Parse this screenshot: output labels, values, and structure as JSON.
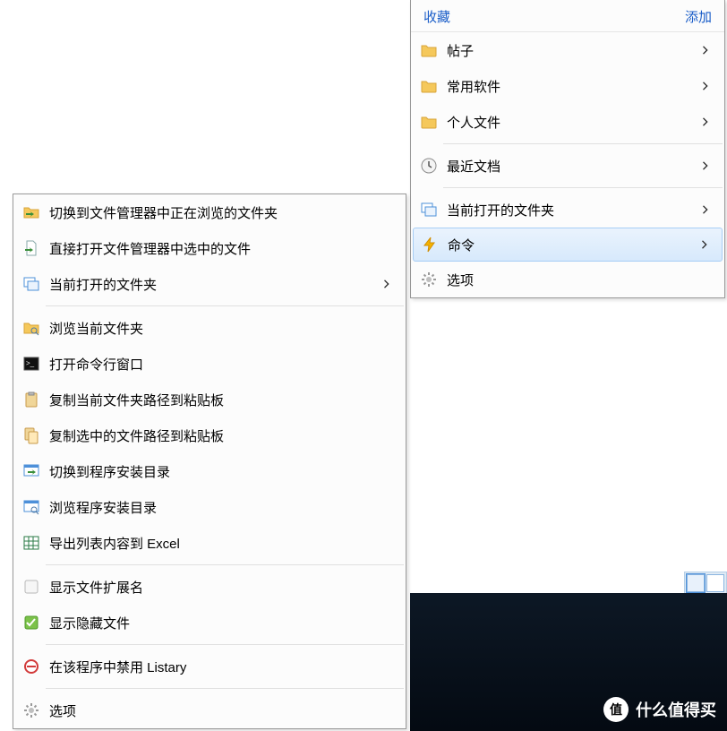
{
  "right_menu": {
    "header": {
      "left": "收藏",
      "right": "添加"
    },
    "items": [
      {
        "id": "posts",
        "icon": "folder",
        "label": "帖子",
        "chevron": true
      },
      {
        "id": "common-sw",
        "icon": "folder",
        "label": "常用软件",
        "chevron": true
      },
      {
        "id": "personal",
        "icon": "folder",
        "label": "个人文件",
        "chevron": true
      },
      {
        "sep": true
      },
      {
        "id": "recent",
        "icon": "clock",
        "label": "最近文档",
        "chevron": true
      },
      {
        "sep": true
      },
      {
        "id": "open-folders",
        "icon": "windows",
        "label": "当前打开的文件夹",
        "chevron": true
      },
      {
        "id": "commands",
        "icon": "bolt",
        "label": "命令",
        "chevron": true,
        "highlight": true
      },
      {
        "id": "options",
        "icon": "gear",
        "label": "选项",
        "chevron": false
      }
    ]
  },
  "left_menu": {
    "items": [
      {
        "id": "switch-fm-folder",
        "icon": "folder-arrow",
        "label": "切换到文件管理器中正在浏览的文件夹",
        "chevron": false
      },
      {
        "id": "open-fm-file",
        "icon": "file-arrow",
        "label": "直接打开文件管理器中选中的文件",
        "chevron": false
      },
      {
        "id": "open-folders-2",
        "icon": "windows",
        "label": "当前打开的文件夹",
        "chevron": true
      },
      {
        "sep": true
      },
      {
        "id": "browse-folder",
        "icon": "folder-search",
        "label": "浏览当前文件夹",
        "chevron": false
      },
      {
        "id": "open-cmd",
        "icon": "terminal",
        "label": "打开命令行窗口",
        "chevron": false
      },
      {
        "id": "copy-folder-path",
        "icon": "clipboard",
        "label": "复制当前文件夹路径到粘贴板",
        "chevron": false
      },
      {
        "id": "copy-file-path",
        "icon": "clipboard-multi",
        "label": "复制选中的文件路径到粘贴板",
        "chevron": false
      },
      {
        "id": "switch-install",
        "icon": "window-go",
        "label": "切换到程序安装目录",
        "chevron": false
      },
      {
        "id": "browse-install",
        "icon": "window-search",
        "label": "浏览程序安装目录",
        "chevron": false
      },
      {
        "id": "export-excel",
        "icon": "excel",
        "label": "导出列表内容到 Excel",
        "chevron": false
      },
      {
        "sep": true
      },
      {
        "id": "show-ext",
        "icon": "check-off",
        "label": "显示文件扩展名",
        "chevron": false
      },
      {
        "id": "show-hidden",
        "icon": "check-on",
        "label": "显示隐藏文件",
        "chevron": false
      },
      {
        "sep": true
      },
      {
        "id": "disable-listary",
        "icon": "forbid",
        "label": "在该程序中禁用 Listary",
        "chevron": false
      },
      {
        "sep": true
      },
      {
        "id": "options-2",
        "icon": "gear",
        "label": "选项",
        "chevron": false
      }
    ]
  },
  "watermark": {
    "badge": "值",
    "text": "什么值得买"
  }
}
